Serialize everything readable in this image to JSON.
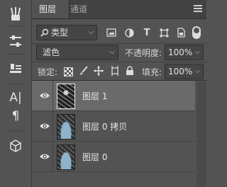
{
  "tabs": [
    {
      "label": "图层"
    },
    {
      "label": "通道"
    }
  ],
  "filter": {
    "kind_label": "类型"
  },
  "blend": {
    "mode": "滤色",
    "opacity_label": "不透明度:",
    "opacity_value": "100%"
  },
  "lock": {
    "label": "锁定:",
    "fill_label": "填充:",
    "fill_value": "100%"
  },
  "layers": [
    {
      "name": "图层 1",
      "selected": true
    },
    {
      "name": "图层 0 拷贝",
      "selected": false
    },
    {
      "name": "图层 0",
      "selected": false
    }
  ],
  "toolbar": {
    "char_glyph": "A|",
    "para_glyph": "¶"
  },
  "colors": {
    "panel_bg": "#535353",
    "selected_row": "#6a6a6a",
    "field_bg": "#454545"
  }
}
